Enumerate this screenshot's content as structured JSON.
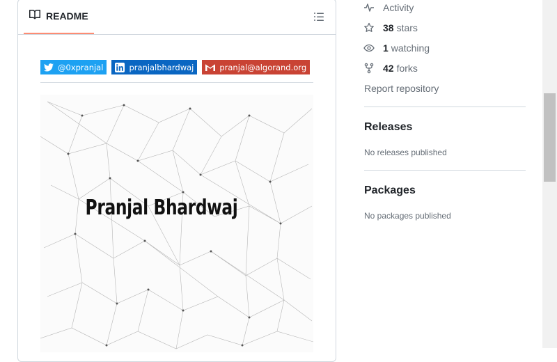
{
  "readme": {
    "tab_label": "README",
    "badges": [
      {
        "label": "@0xpranjal",
        "icon": "twitter-icon",
        "color": "#1da1f2"
      },
      {
        "label": "pranjalbhardwaj",
        "icon": "linkedin-icon",
        "color": "#0a66c2"
      },
      {
        "label": "pranjal@algorand.org",
        "icon": "gmail-icon",
        "color": "#c94334"
      }
    ],
    "banner_text": "Pranjal Bhardwaj"
  },
  "sidebar": {
    "activity_label": "Activity",
    "stars": {
      "count": "38",
      "label": "stars"
    },
    "watching": {
      "count": "1",
      "label": "watching"
    },
    "forks": {
      "count": "42",
      "label": "forks"
    },
    "report_label": "Report repository",
    "releases": {
      "heading": "Releases",
      "note": "No releases published"
    },
    "packages": {
      "heading": "Packages",
      "note": "No packages published"
    }
  },
  "colors": {
    "tab_underline": "#fd8c73",
    "border": "#d0d7de",
    "muted_text": "#656d76"
  }
}
